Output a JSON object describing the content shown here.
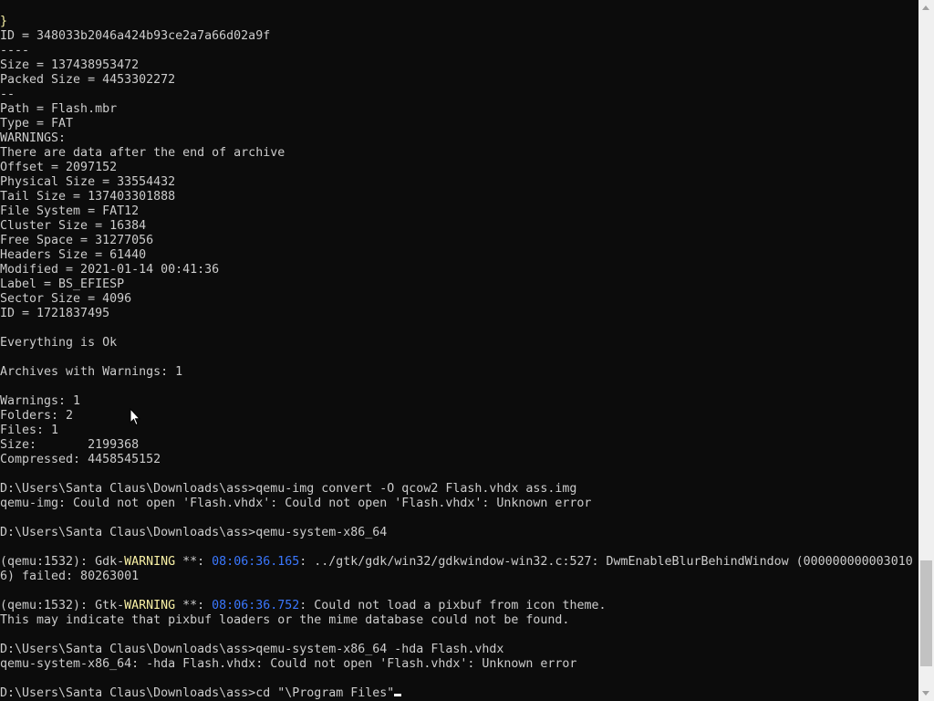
{
  "console": {
    "lines": [
      [
        {
          "t": "}",
          "c": "y"
        }
      ],
      [
        {
          "t": "ID = 348033b2046a424b93ce2a7a66d02a9f"
        }
      ],
      [
        {
          "t": "----"
        }
      ],
      [
        {
          "t": "Size = 137438953472"
        }
      ],
      [
        {
          "t": "Packed Size = 4453302272"
        }
      ],
      [
        {
          "t": "--"
        }
      ],
      [
        {
          "t": "Path = Flash.mbr"
        }
      ],
      [
        {
          "t": "Type = FAT"
        }
      ],
      [
        {
          "t": "WARNINGS:"
        }
      ],
      [
        {
          "t": "There are data after the end of archive"
        }
      ],
      [
        {
          "t": "Offset = 2097152"
        }
      ],
      [
        {
          "t": "Physical Size = 33554432"
        }
      ],
      [
        {
          "t": "Tail Size = 137403301888"
        }
      ],
      [
        {
          "t": "File System = FAT12"
        }
      ],
      [
        {
          "t": "Cluster Size = 16384"
        }
      ],
      [
        {
          "t": "Free Space = 31277056"
        }
      ],
      [
        {
          "t": "Headers Size = 61440"
        }
      ],
      [
        {
          "t": "Modified = 2021-01-14 00:41:36"
        }
      ],
      [
        {
          "t": "Label = BS_EFIESP"
        }
      ],
      [
        {
          "t": "Sector Size = 4096"
        }
      ],
      [
        {
          "t": "ID = 1721837495"
        }
      ],
      [],
      [
        {
          "t": "Everything is Ok"
        }
      ],
      [],
      [
        {
          "t": "Archives with Warnings: 1"
        }
      ],
      [],
      [
        {
          "t": "Warnings: 1"
        }
      ],
      [
        {
          "t": "Folders: 2"
        }
      ],
      [
        {
          "t": "Files: 1"
        }
      ],
      [
        {
          "t": "Size:       2199368"
        }
      ],
      [
        {
          "t": "Compressed: 4458545152"
        }
      ],
      [],
      [
        {
          "t": "D:\\Users\\Santa Claus\\Downloads\\ass>qemu-img convert -O qcow2 Flash.vhdx ass.img"
        }
      ],
      [
        {
          "t": "qemu-img: Could not open 'Flash.vhdx': Could not open 'Flash.vhdx': Unknown error"
        }
      ],
      [],
      [
        {
          "t": "D:\\Users\\Santa Claus\\Downloads\\ass>qemu-system-x86_64"
        }
      ],
      [],
      [
        {
          "t": "(qemu:1532): Gdk-"
        },
        {
          "t": "WARNING",
          "c": "y"
        },
        {
          "t": " **: "
        },
        {
          "t": "08:06:36.165",
          "c": "b"
        },
        {
          "t": ": ../gtk/gdk/win32/gdkwindow-win32.c:527: DwmEnableBlurBehindWindow (000000000003010"
        }
      ],
      [
        {
          "t": "6) failed: 80263001"
        }
      ],
      [],
      [
        {
          "t": "(qemu:1532): Gtk-"
        },
        {
          "t": "WARNING",
          "c": "y"
        },
        {
          "t": " **: "
        },
        {
          "t": "08:06:36.752",
          "c": "b"
        },
        {
          "t": ": Could not load a pixbuf from icon theme."
        }
      ],
      [
        {
          "t": "This may indicate that pixbuf loaders or the mime database could not be found."
        }
      ],
      [],
      [
        {
          "t": "D:\\Users\\Santa Claus\\Downloads\\ass>qemu-system-x86_64 -hda Flash.vhdx"
        }
      ],
      [
        {
          "t": "qemu-system-x86_64: -hda Flash.vhdx: Could not open 'Flash.vhdx': Unknown error"
        }
      ],
      [],
      [
        {
          "t": "D:\\Users\\Santa Claus\\Downloads\\ass>cd \"\\Program Files\""
        },
        {
          "cursor": true
        }
      ]
    ]
  },
  "colors": {
    "background": "#0c0c0c",
    "text": "#cccccc",
    "warning": "#f9f1a5",
    "timestamp": "#3b78ff"
  },
  "icons": {
    "scroll_up": "arrow-up-icon",
    "scroll_down": "arrow-down-icon",
    "pointer": "mouse-pointer-icon"
  }
}
